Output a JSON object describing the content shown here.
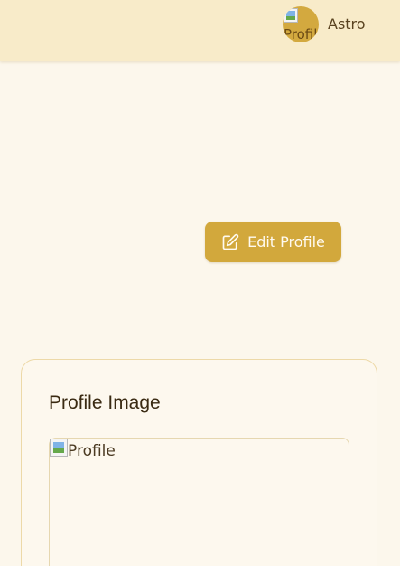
{
  "header": {
    "user": {
      "name": "Astro",
      "avatar_alt": "Profile",
      "avatar_bg": "#d3a93f"
    }
  },
  "main": {
    "edit_button": {
      "label": "Edit Profile",
      "icon": "edit-icon",
      "color": "#d2a83c"
    },
    "profile_image_card": {
      "title": "Profile Image",
      "image_alt": "Profile"
    }
  },
  "colors": {
    "background": "#fcf7ec",
    "topbar": "#f8ebc9",
    "accent": "#d2a83c"
  }
}
